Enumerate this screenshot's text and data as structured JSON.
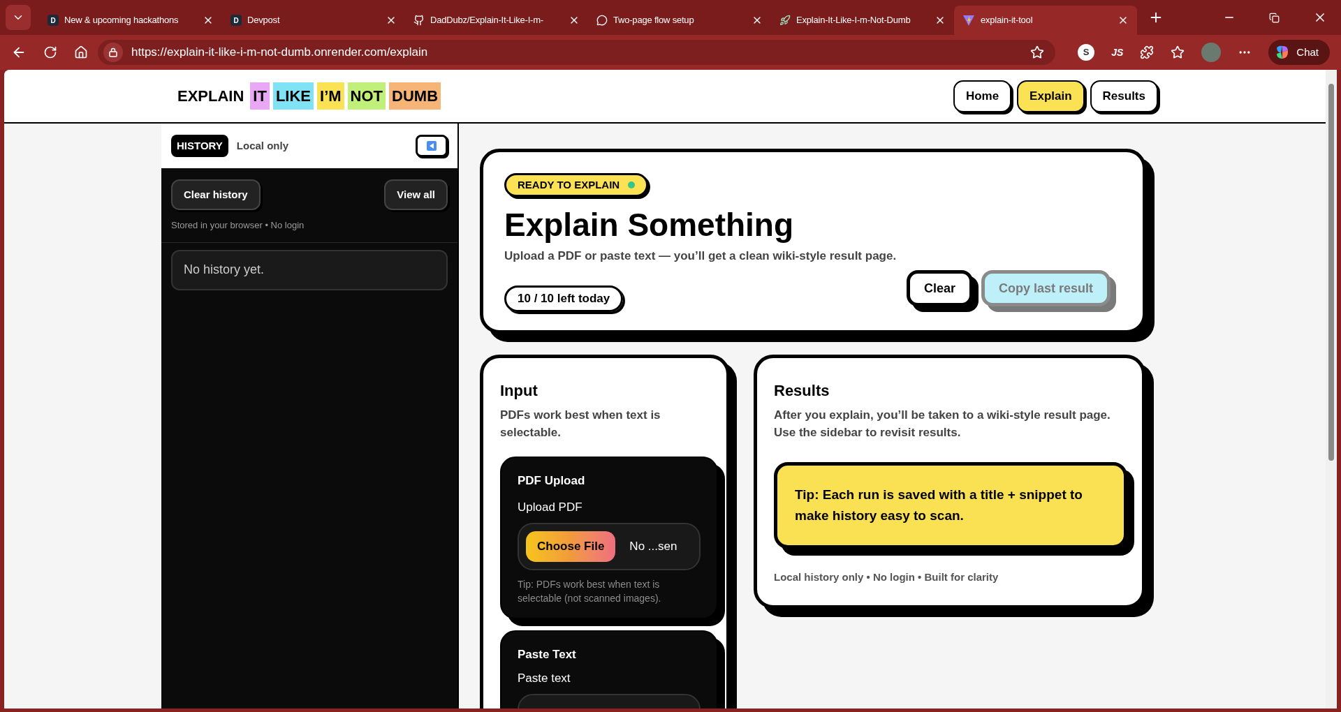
{
  "browser": {
    "tabs": [
      {
        "title": "New & upcoming hackathons",
        "kind": "letter",
        "icon_text": "D",
        "selected": false
      },
      {
        "title": "Devpost",
        "kind": "letter",
        "icon_text": "D",
        "selected": false
      },
      {
        "title": "DadDubz/Explain-It-Like-I-m-",
        "kind": "repo",
        "selected": false
      },
      {
        "title": "Two-page flow setup",
        "kind": "chat",
        "selected": false
      },
      {
        "title": "Explain-It-Like-I-m-Not-Dumb",
        "kind": "deploy",
        "selected": false
      },
      {
        "title": "explain-it-tool",
        "kind": "tool",
        "selected": true
      }
    ],
    "url": "https://explain-it-like-i-m-not-dumb.onrender.com/explain",
    "extensions": [
      "S",
      "JS"
    ],
    "chat_label": "Chat"
  },
  "header": {
    "logo": [
      {
        "word": "EXPLAIN"
      },
      {
        "word": "IT",
        "color": "#e9a8f5"
      },
      {
        "word": "LIKE",
        "color": "#7fe3f5"
      },
      {
        "word": "I’M",
        "color": "#fbe154"
      },
      {
        "word": "NOT",
        "color": "#c1f07a"
      },
      {
        "word": "DUMB",
        "color": "#f7b477"
      }
    ],
    "nav": [
      {
        "label": "Home",
        "selected": false
      },
      {
        "label": "Explain",
        "selected": true
      },
      {
        "label": "Results",
        "selected": false
      }
    ]
  },
  "sidebar": {
    "badge": "HISTORY",
    "note": "Local only",
    "buttons": [
      "Clear history",
      "View all"
    ],
    "storage_note": "Stored in your browser • No login",
    "empty": "No history yet."
  },
  "hero": {
    "status": "READY TO EXPLAIN",
    "title": "Explain Something",
    "subtitle": "Upload a PDF or paste text — you’ll get a clean wiki-style result page.",
    "quota": "10 / 10 left today",
    "actions": [
      {
        "label": "Clear",
        "disabled": false
      },
      {
        "label": "Copy last result",
        "disabled": true
      }
    ]
  },
  "input": {
    "title": "Input",
    "subtitle": "PDFs work best when text is selectable.",
    "pdf": {
      "title": "PDF Upload",
      "label": "Upload PDF",
      "button": "Choose File",
      "file": "No ...sen",
      "tip": "Tip: PDFs work best when text is selectable (not scanned images)."
    },
    "paste": {
      "title": "Paste Text",
      "label": "Paste text"
    }
  },
  "results": {
    "title": "Results",
    "description": "After you explain, you’ll be taken to a wiki-style result page. Use the sidebar to revisit results.",
    "tip": "Tip: Each run is saved with a title + snippet to make history easy to scan.",
    "footer": "Local history only • No login • Built for clarity"
  }
}
